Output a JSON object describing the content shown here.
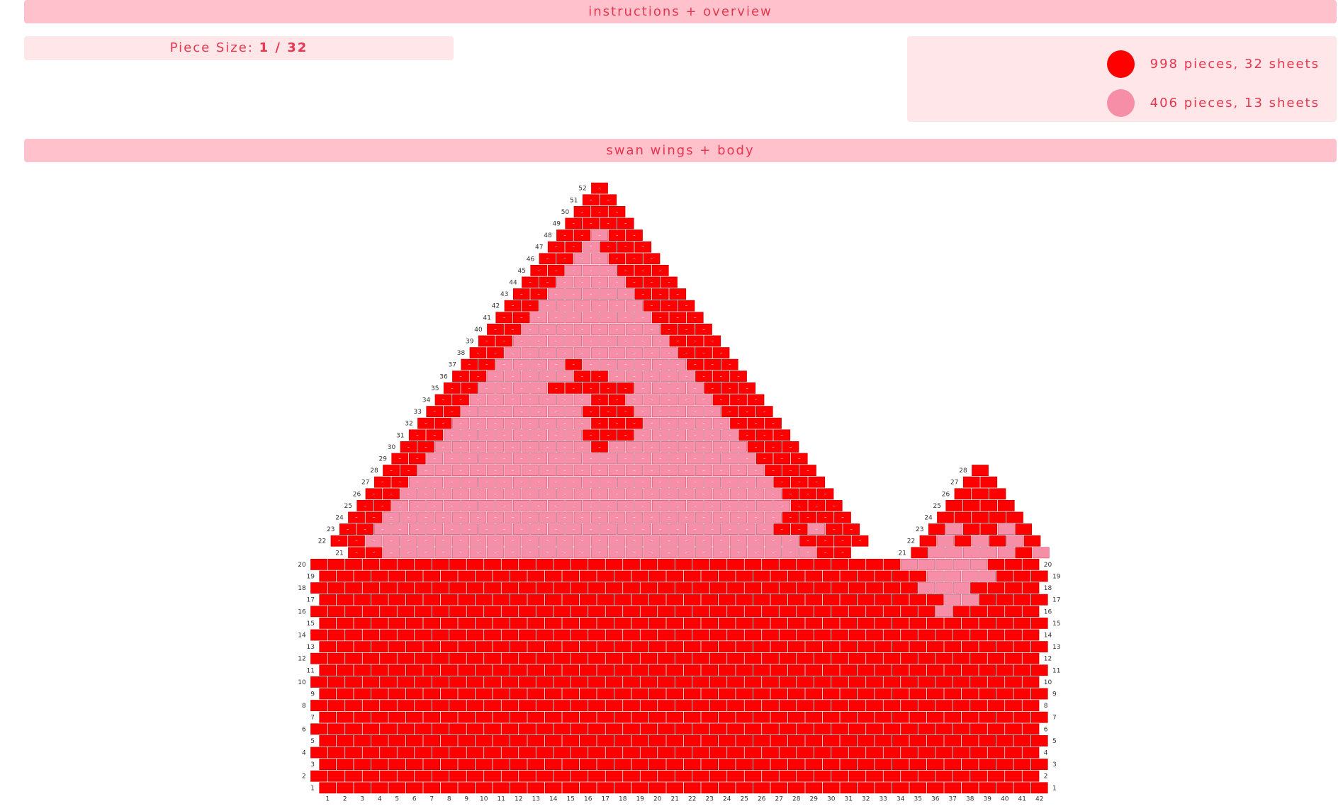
{
  "header": {
    "label": "instructions + overview"
  },
  "piece_size": {
    "label": "Piece Size:",
    "value": "1 / 32"
  },
  "legend": {
    "items": [
      {
        "color": "#ff0000",
        "text": "998 pieces, 32 sheets"
      },
      {
        "color": "#f78ea8",
        "text": "406 pieces, 13 sheets"
      }
    ]
  },
  "section": {
    "label": "swan wings + body"
  },
  "grid": {
    "colors": {
      "red": "#ff0000",
      "pink": "#f78ea8"
    },
    "columns": [
      "1",
      "2",
      "3",
      "4",
      "5",
      "6",
      "7",
      "8",
      "9",
      "10",
      "11",
      "12",
      "13",
      "14",
      "15",
      "16",
      "17",
      "18",
      "19",
      "20",
      "21",
      "22",
      "23",
      "24",
      "25",
      "26",
      "27",
      "28",
      "29",
      "30",
      "31",
      "32",
      "33",
      "34",
      "35",
      "36",
      "37",
      "38",
      "39",
      "40",
      "41",
      "42"
    ],
    "base_rows": [
      "1",
      "2",
      "3",
      "4",
      "5",
      "6",
      "7",
      "8",
      "9",
      "10",
      "11",
      "12",
      "13",
      "14",
      "15",
      "16",
      "17",
      "18",
      "19",
      "20"
    ],
    "base_pink": {
      "20": [
        35,
        36,
        37,
        38,
        39
      ],
      "19": [
        36,
        37,
        38,
        39
      ],
      "18": [
        36,
        37,
        38
      ],
      "17": [
        37,
        38
      ],
      "16": [
        37
      ]
    },
    "wing_rows": {
      "21": {
        "red": [
          0,
          1,
          27,
          28
        ]
      },
      "22": {
        "red": [
          0,
          1,
          27,
          28
        ]
      },
      "23": {
        "red": [
          0,
          1,
          25,
          26
        ]
      },
      "24": {
        "red": [
          0,
          1,
          25,
          26
        ]
      },
      "25": {
        "red": [
          0,
          1,
          25,
          26
        ]
      },
      "26": {
        "red": [
          0,
          1,
          24,
          25
        ]
      },
      "27": {
        "red": [
          0,
          1,
          23,
          24
        ]
      },
      "28": {
        "red": [
          0,
          1,
          22,
          23
        ]
      },
      "29": {
        "red": [
          0,
          1,
          21,
          22
        ]
      },
      "30": {
        "red": [
          0,
          1,
          11,
          20,
          21
        ]
      },
      "31": {
        "red": [
          0,
          1,
          10,
          11,
          12,
          19,
          20
        ]
      },
      "32": {
        "red": [
          0,
          1,
          10,
          11,
          12,
          18,
          19
        ]
      },
      "33": {
        "red": [
          0,
          1,
          9,
          10,
          11,
          17,
          18
        ]
      },
      "34": {
        "red": [
          0,
          1,
          9,
          10,
          16,
          17
        ]
      },
      "35": {
        "red": [
          0,
          1,
          6,
          7,
          8,
          9,
          10,
          15,
          16
        ]
      },
      "36": {
        "red": [
          0,
          1,
          7,
          8,
          14,
          15
        ]
      },
      "37": {
        "red": [
          0,
          1,
          6,
          13,
          14
        ]
      },
      "38": {
        "red": [
          0,
          1,
          12,
          13
        ]
      },
      "39": {
        "red": [
          0,
          1,
          11,
          12
        ]
      },
      "40": {
        "red": [
          0,
          1,
          10,
          11
        ]
      },
      "41": {
        "red": [
          0,
          1,
          9,
          10
        ]
      },
      "42": {
        "red": [
          0,
          1,
          8,
          9
        ]
      },
      "43": {
        "red": [
          0,
          1,
          7,
          8
        ]
      },
      "44": {
        "red": [
          0,
          1,
          6,
          7
        ]
      },
      "45": {
        "red": [
          0,
          1,
          5,
          6
        ]
      },
      "46": {
        "red": [
          0,
          1,
          4,
          5
        ]
      },
      "47": {
        "red": [
          0,
          1,
          3,
          4
        ]
      },
      "48": {
        "red": [
          0,
          1,
          3,
          4
        ]
      },
      "49": {
        "red": [
          0,
          1,
          2,
          3
        ]
      },
      "50": {
        "red": [
          0,
          1,
          2
        ]
      },
      "51": {
        "red": [
          0,
          1
        ]
      },
      "52": {
        "red": [
          0
        ]
      }
    },
    "neck_rows": {
      "21": {
        "red": [
          0,
          6
        ]
      },
      "22": {
        "red": [
          0,
          2,
          4,
          6
        ]
      },
      "23": {
        "red": [
          0,
          2,
          3,
          5
        ]
      },
      "24": {
        "red": [
          0,
          1,
          2,
          3,
          4,
          5
        ]
      },
      "25": {
        "red": [
          0,
          1,
          2,
          3
        ]
      },
      "26": {
        "red": [
          0,
          1,
          2
        ]
      },
      "27": {
        "red": [
          0,
          1
        ]
      },
      "28": {
        "red": [
          0
        ]
      }
    }
  }
}
